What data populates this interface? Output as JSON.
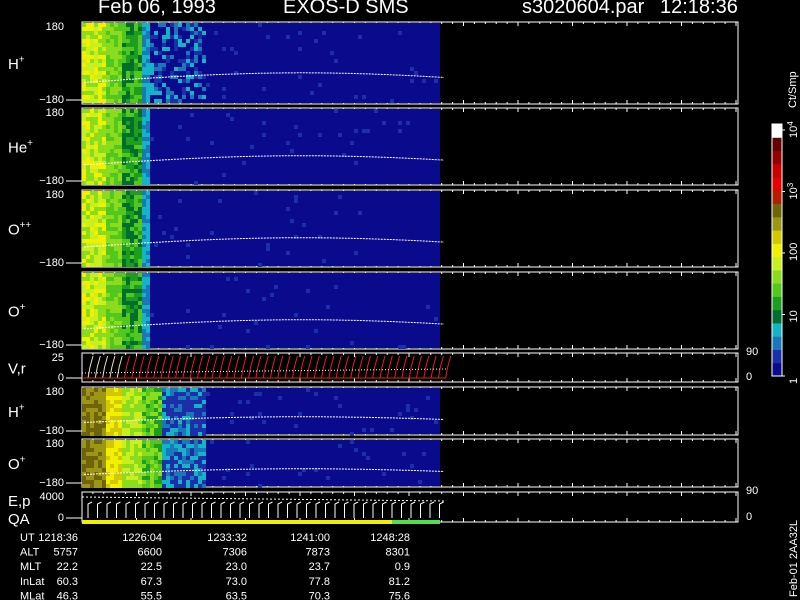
{
  "header": {
    "date": "Feb 06, 1993",
    "instrument": "EXOS-D SMS",
    "file": "s3020604.par",
    "time": "12:18:36"
  },
  "colorbar": {
    "unit": "Ct/Smp",
    "ticks": [
      {
        "label": "1",
        "value": 1
      },
      {
        "label": "10",
        "value": 10
      },
      {
        "label": "100",
        "value": 100
      },
      {
        "label": "10",
        "sup": "3",
        "value": 1000
      },
      {
        "label": "10",
        "sup": "4",
        "value": 10000
      }
    ],
    "colors": [
      "#0a0a8c",
      "#1c2ea8",
      "#1a78b8",
      "#14b4c8",
      "#006e2c",
      "#1e9e1e",
      "#52c81e",
      "#8cdc1e",
      "#c8f01e",
      "#f0f000",
      "#d2c800",
      "#9c9614",
      "#6e640a",
      "#b41e00",
      "#e60000",
      "#c80000",
      "#960000",
      "#640000",
      "#ffffff"
    ]
  },
  "chart_data": {
    "type": "heatmap",
    "title": "Feb 06, 1993   EXOS-D SMS",
    "time_range": [
      "12:18:36",
      "12:51:00"
    ],
    "panels": [
      {
        "label": "H",
        "sup": "+",
        "type": "heatmap",
        "ylim": [
          -180,
          180
        ],
        "ticks": [
          "180",
          "−180"
        ]
      },
      {
        "label": "He",
        "sup": "+",
        "type": "heatmap",
        "ylim": [
          -180,
          180
        ],
        "ticks": [
          "180",
          "−180"
        ]
      },
      {
        "label": "O",
        "sup": "++",
        "type": "heatmap",
        "ylim": [
          -180,
          180
        ],
        "ticks": [
          "180",
          "−180"
        ]
      },
      {
        "label": "O",
        "sup": "+",
        "type": "heatmap",
        "ylim": [
          -180,
          180
        ],
        "ticks": [
          "",
          "−180"
        ]
      },
      {
        "label": "V,r",
        "sup": "",
        "type": "line",
        "ylim": [
          0,
          25
        ],
        "ticks": [
          "25",
          "0"
        ],
        "right_ticks": [
          "90",
          "0"
        ]
      },
      {
        "label": "H",
        "sup": "+",
        "type": "heatmap",
        "ylim": [
          -180,
          180
        ],
        "ticks": [
          "180",
          "−180"
        ]
      },
      {
        "label": "O",
        "sup": "+",
        "type": "heatmap",
        "ylim": [
          -180,
          180
        ],
        "ticks": [
          "180",
          "−180"
        ]
      },
      {
        "label": "E,p",
        "sup": "",
        "label2": "QA",
        "type": "line",
        "ylim": [
          0,
          4000
        ],
        "ticks": [
          "4000",
          "0"
        ],
        "right_ticks": [
          "90",
          "0"
        ]
      }
    ],
    "ephemeris": {
      "row_labels": [
        "UT",
        "ALT",
        "MLT",
        "InLat",
        "MLat"
      ],
      "columns": [
        [
          "1218:36",
          "5757",
          "22.2",
          "60.3",
          "46.3"
        ],
        [
          "1226:04",
          "6600",
          "22.5",
          "67.3",
          "55.5"
        ],
        [
          "1233:32",
          "7306",
          "23.0",
          "73.0",
          "63.5"
        ],
        [
          "1241:00",
          "7873",
          "23.7",
          "77.8",
          "70.3"
        ],
        [
          "1248:28",
          "8301",
          "0.9",
          "81.2",
          "75.6"
        ]
      ]
    }
  },
  "footer": {
    "vertical_label": "Feb-01 2AA32L"
  }
}
